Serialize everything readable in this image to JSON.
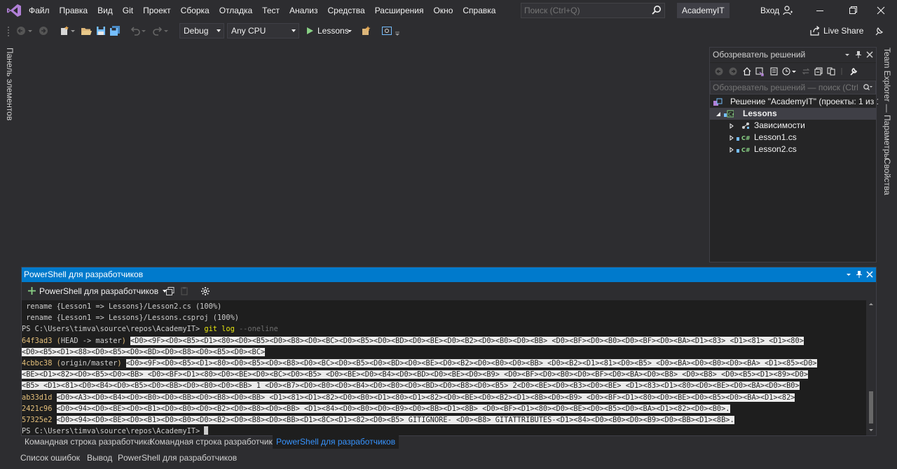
{
  "menu": {
    "items": [
      "Файл",
      "Правка",
      "Вид",
      "Git",
      "Проект",
      "Сборка",
      "Отладка",
      "Тест",
      "Анализ",
      "Средства",
      "Расширения",
      "Окно",
      "Справка"
    ],
    "search_placeholder": "Поиск (Ctrl+Q)",
    "solution_name": "AcademyIT",
    "signin_label": "Вход"
  },
  "toolbar": {
    "configuration": "Debug",
    "platform": "Any CPU",
    "run_target": "Lessons",
    "liveshare_label": "Live Share"
  },
  "side_tabs": {
    "left": "Панель элементов",
    "right": [
      "Team Explorer — Параметры",
      "Свойства"
    ]
  },
  "solution_explorer": {
    "title": "Обозреватель решений",
    "search_placeholder": "Обозреватель решений — поиск (Ctrl+",
    "tree": [
      {
        "label": "Решение \"AcademyIT\" (проекты: 1 из 1)",
        "icon": "solution-icon"
      },
      {
        "label": "Lessons",
        "icon": "csharp-project-icon"
      },
      {
        "label": "Зависимости",
        "icon": "dependencies-icon"
      },
      {
        "label": "Lesson1.cs",
        "icon": "csharp-file-icon"
      },
      {
        "label": "Lesson2.cs",
        "icon": "csharp-file-icon"
      }
    ]
  },
  "terminal": {
    "title": "PowerShell для разработчиков",
    "profile": "PowerShell для разработчиков",
    "lines": [
      {
        "parts": [
          {
            "t": " rename {Lesson1 => Lessons}/Lesson2.cs (100%)",
            "c": ""
          }
        ]
      },
      {
        "parts": [
          {
            "t": " rename {Lesson1 => Lessons}/Lessons.csproj (100%)",
            "c": ""
          }
        ]
      },
      {
        "parts": [
          {
            "t": "PS C:\\Users\\timva\\source\\repos\\AcademyIT> ",
            "c": ""
          },
          {
            "t": "git log",
            "c": "hl-cmd"
          },
          {
            "t": " --oneline",
            "c": "hl-dim"
          }
        ]
      },
      {
        "parts": [
          {
            "t": "64f3ad3",
            "c": "hl-yellow"
          },
          {
            "t": " (",
            "c": "hl-yellow"
          },
          {
            "t": "HEAD -> master",
            "c": "hl-head"
          },
          {
            "t": ") ",
            "c": "hl-yellow"
          },
          {
            "t": "<D0><9F><D0><B5><D1><80><D0><B5><D0><B8><D0><BC><D0><B5><D0><BD><D0><BE><D0><B2><D0><B0><D0><BB> <D0><BF><D0><B0><D0><BF><D0><BA><D1><83> <D1><81> <D1><80>",
            "c": "sel"
          }
        ]
      },
      {
        "parts": [
          {
            "t": "<D0><B5><D1><88><D0><B5><D0><BD><D0><B8><D0><B5><D0><BC>",
            "c": "sel"
          }
        ]
      },
      {
        "parts": [
          {
            "t": "4cbbc38",
            "c": "hl-yellow"
          },
          {
            "t": " (",
            "c": "hl-yellow"
          },
          {
            "t": "origin/master",
            "c": "hl-red"
          },
          {
            "t": ") ",
            "c": "hl-yellow"
          },
          {
            "t": "<D0><9F><D0><B5><D1><80><D0><B5><D0><B8><D0><BC><D0><B5><D0><BD><D0><BE><D0><B2><D0><B0><D0><BB> <D0><B2><D1><81><D0><B5> <D0><BA><D0><B0><D0><BA> <D1><85><D0>",
            "c": "sel"
          }
        ]
      },
      {
        "parts": [
          {
            "t": "<BE><D1><82><D0><B5><D0><BB> <D0><BF><D1><80><D0><BE><D0><BC><D0><B5> <D0><BE><D0><B4><D0><BD><D0><BE><D0><B9> <D0><BF><D0><B0><D0><BF><D0><BA><D0><B8> <D0><B8> <D0><B5><D1><89><D0>",
            "c": "sel"
          }
        ]
      },
      {
        "parts": [
          {
            "t": "<B5> <D1><81><D0><B4><D0><B5><D0><BB><D0><B0><D0><BB> 1 <D0><B7><D0><B0><D0><B4><D0><B0><D0><BD><D0><B8><D0><B5> 2<D0><BE><D0><B3><D0><BE> <D1><83><D1><80><D0><BE><D0><BA><D0><B0>",
            "c": "sel"
          }
        ]
      },
      {
        "parts": [
          {
            "t": "ab33d1d",
            "c": "hl-yellow"
          },
          {
            "t": " ",
            "c": ""
          },
          {
            "t": "<D0><A3><D0><B4><D0><B0><D0><BB><D0><B8><D0><BB> <D1><81><D1><82><D0><B0><D1><80><D1><82><D0><BE><D0><B2><D1><8B><D0><B9> <D0><BF><D1><80><D0><BE><D0><B5><D0><BA><D1><82>",
            "c": "sel"
          }
        ]
      },
      {
        "parts": [
          {
            "t": "2421c96",
            "c": "hl-yellow"
          },
          {
            "t": " ",
            "c": ""
          },
          {
            "t": "<D0><94><D0><BE><D0><B1><D0><B0><D0><B2><D0><B8><D0><BB> <D1><84><D0><B0><D0><B9><D0><BB><D1><8B> <D0><BF><D1><80><D0><BE><D0><B5><D0><BA><D1><82><D0><B0>.",
            "c": "sel"
          }
        ]
      },
      {
        "parts": [
          {
            "t": "57325e2",
            "c": "hl-yellow"
          },
          {
            "t": " ",
            "c": ""
          },
          {
            "t": "<D0><94><D0><BE><D0><B1><D0><B0><D0><B2><D0><B8><D0><BB><D1><8C><D1><82><D0><B5> GITIGNORE- <D0><B8> GITATTRIBUTES-<D1><84><D0><B0><D0><B9><D0><BB><D1><8B>.",
            "c": "sel"
          }
        ]
      },
      {
        "parts": [
          {
            "t": "PS C:\\Users\\timva\\source\\repos\\AcademyIT> ",
            "c": ""
          }
        ]
      }
    ]
  },
  "bottom_tabs_row1": [
    "Командная строка разработчика",
    "Командная строка разработчика",
    "PowerShell для разработчиков"
  ],
  "bottom_tabs_row2": [
    "Список ошибок",
    "Вывод",
    "PowerShell для разработчиков"
  ],
  "colors": {
    "accent": "#007acc",
    "background": "#2d2d30",
    "terminal_bg": "#1e1e1e",
    "active_tab_text": "#3794ff"
  }
}
